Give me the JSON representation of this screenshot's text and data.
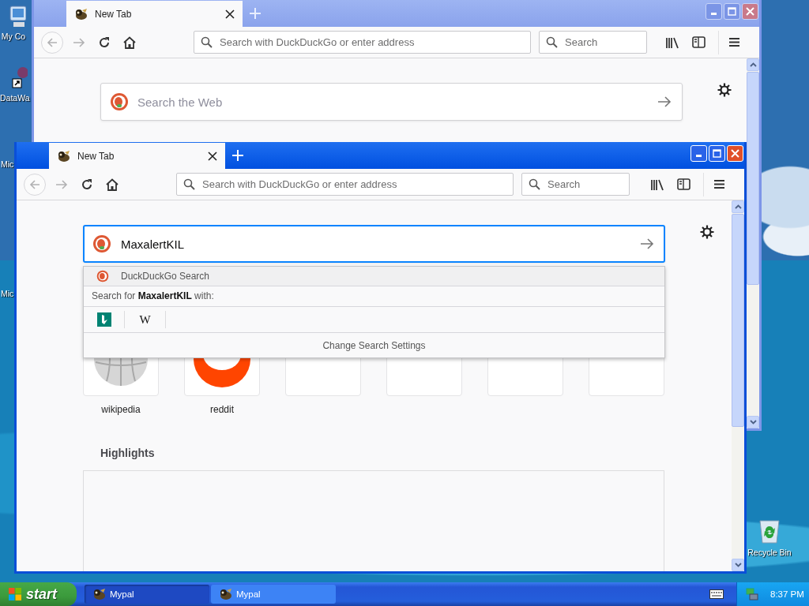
{
  "desktop_icons": [
    {
      "label": "My Co",
      "kind": "computer"
    },
    {
      "label": "DataWa",
      "kind": "shortcut"
    },
    {
      "label": "Mic",
      "kind": "none"
    },
    {
      "label": "Mic",
      "kind": "none"
    },
    {
      "label": "Recycle Bin",
      "kind": "bin"
    }
  ],
  "windows": [
    {
      "active": false,
      "tab": {
        "title": "New Tab"
      },
      "address_bar": {
        "placeholder": "Search with DuckDuckGo or enter address"
      },
      "search_bar": {
        "placeholder": "Search"
      },
      "page": {
        "search": {
          "placeholder": "Search the Web"
        }
      }
    },
    {
      "active": true,
      "tab": {
        "title": "New Tab"
      },
      "address_bar": {
        "placeholder": "Search with DuckDuckGo or enter address"
      },
      "search_bar": {
        "placeholder": "Search"
      },
      "page": {
        "search": {
          "value": "MaxalertKIL"
        },
        "suggestions": {
          "engine": "DuckDuckGo Search",
          "search_for": "Search for **MaxalertKIL** with:",
          "engines": [
            {
              "kind": "bing"
            },
            {
              "kind": "wiki",
              "label": "W"
            }
          ],
          "settings_link": "Change Search Settings"
        },
        "top_sites": [
          {
            "label": "wikipedia",
            "kind": "globe"
          },
          {
            "label": "reddit",
            "kind": "orange"
          },
          {
            "kind": "empty"
          },
          {
            "kind": "empty"
          },
          {
            "kind": "empty"
          },
          {
            "kind": "empty"
          }
        ],
        "highlights": {
          "title": "Highlights"
        }
      }
    }
  ],
  "taskbar": {
    "start": "start",
    "tasks": [
      {
        "label": "Mypal",
        "selected": true
      },
      {
        "label": "Mypal",
        "selected": false
      }
    ],
    "clock": "8:37 PM"
  }
}
